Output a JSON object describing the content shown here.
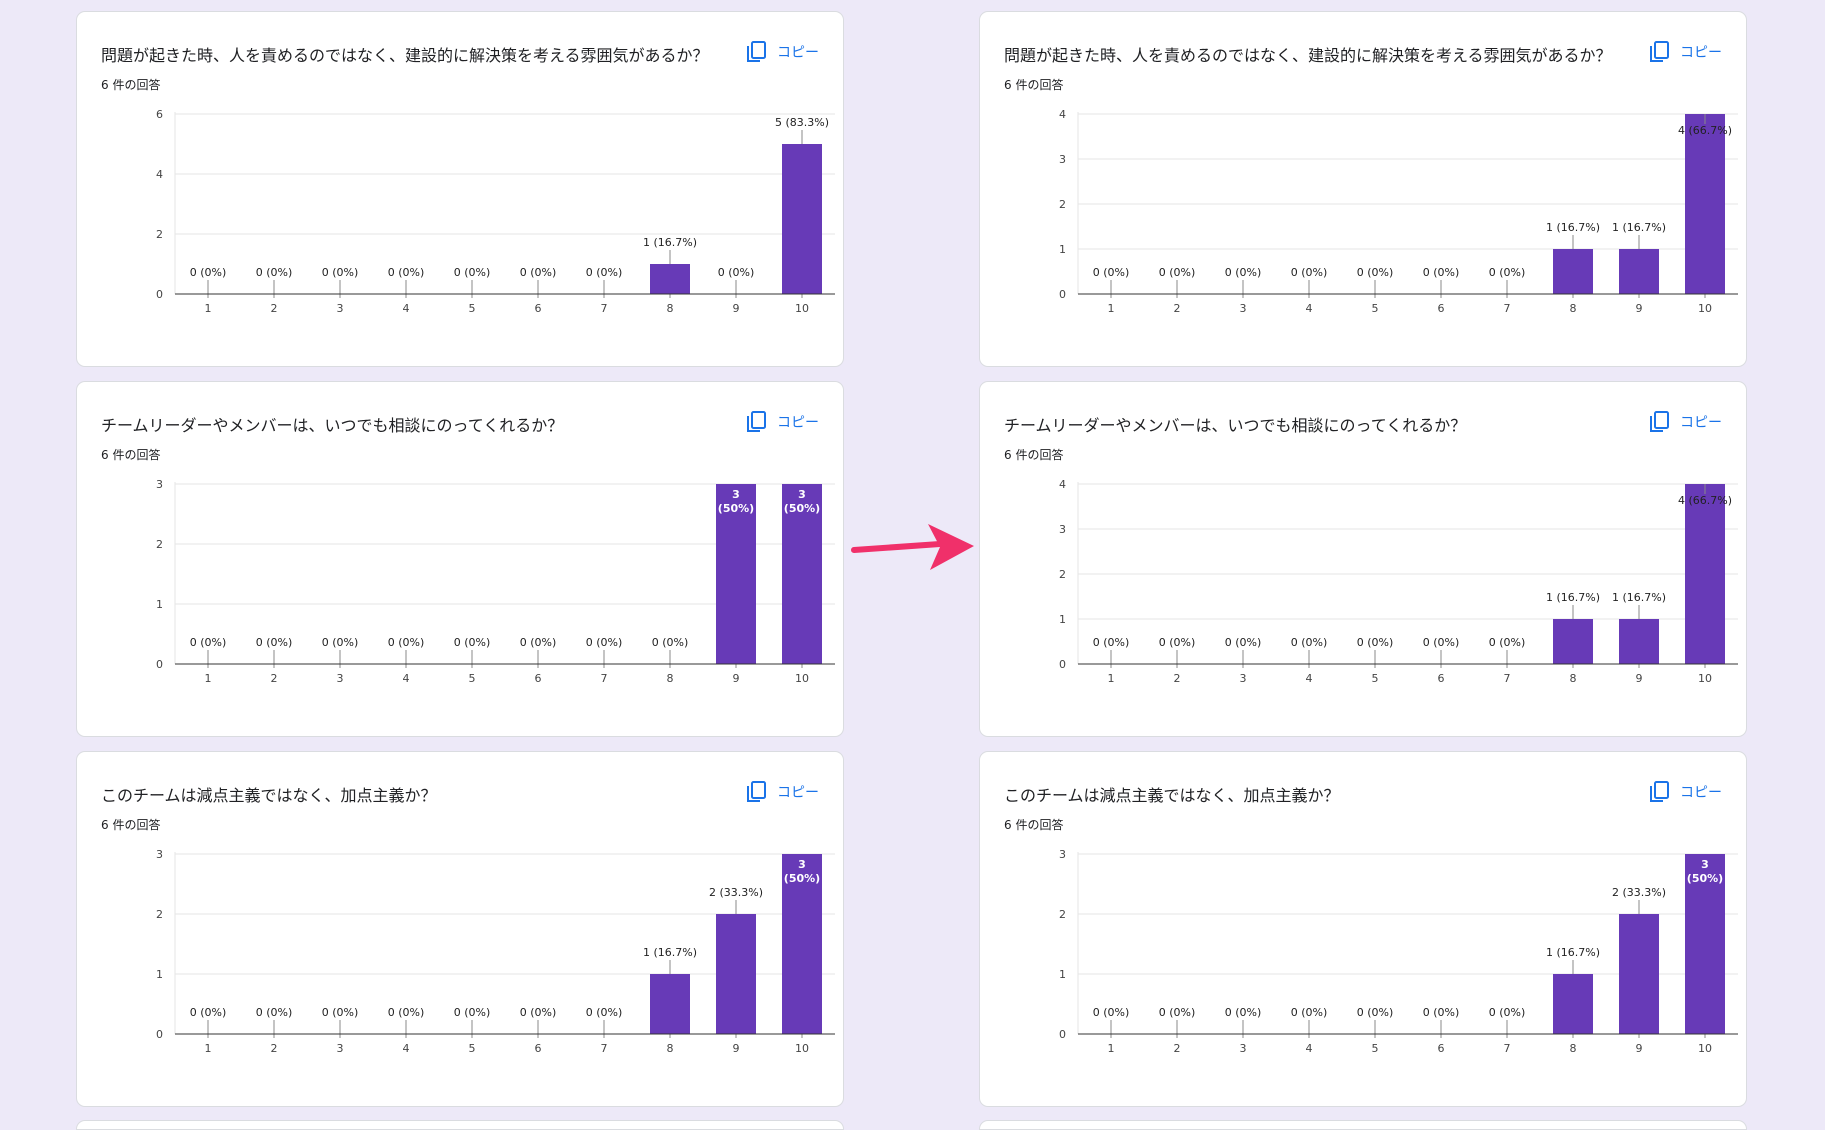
{
  "colors": {
    "bar": "#673ab7",
    "copy": "#1a73e8",
    "arrow": "#f0306a"
  },
  "icons": {
    "copy": "copy-icon",
    "arrow": "arrow-icon"
  },
  "left": {
    "cards": [
      {
        "title": "問題が起きた時、人を責めるのではなく、建設的に解決策を考える雰囲気があるか？",
        "count": "6 件の回答",
        "copy_label": "コピー",
        "chart_data": {
          "type": "bar",
          "categories": [
            "1",
            "2",
            "3",
            "4",
            "5",
            "6",
            "7",
            "8",
            "9",
            "10"
          ],
          "values": [
            0,
            0,
            0,
            0,
            0,
            0,
            0,
            1,
            0,
            5
          ],
          "labels": [
            "0 (0%)",
            "0 (0%)",
            "0 (0%)",
            "0 (0%)",
            "0 (0%)",
            "0 (0%)",
            "0 (0%)",
            "1 (16.7%)",
            "0 (0%)",
            "5 (83.3%)"
          ],
          "yticks": [
            0,
            2,
            4,
            6
          ],
          "ylim": [
            0,
            6
          ]
        }
      },
      {
        "title": "チームリーダーやメンバーは、いつでも相談にのってくれるか？",
        "count": "6 件の回答",
        "copy_label": "コピー",
        "chart_data": {
          "type": "bar",
          "categories": [
            "1",
            "2",
            "3",
            "4",
            "5",
            "6",
            "7",
            "8",
            "9",
            "10"
          ],
          "values": [
            0,
            0,
            0,
            0,
            0,
            0,
            0,
            0,
            3,
            3
          ],
          "labels": [
            "0 (0%)",
            "0 (0%)",
            "0 (0%)",
            "0 (0%)",
            "0 (0%)",
            "0 (0%)",
            "0 (0%)",
            "0 (0%)",
            "3\n(50%)",
            "3\n(50%)"
          ],
          "yticks": [
            0,
            1,
            2,
            3
          ],
          "ylim": [
            0,
            3
          ]
        }
      },
      {
        "title": "このチームは減点主義ではなく、加点主義か？",
        "count": "6 件の回答",
        "copy_label": "コピー",
        "chart_data": {
          "type": "bar",
          "categories": [
            "1",
            "2",
            "3",
            "4",
            "5",
            "6",
            "7",
            "8",
            "9",
            "10"
          ],
          "values": [
            0,
            0,
            0,
            0,
            0,
            0,
            0,
            1,
            2,
            3
          ],
          "labels": [
            "0 (0%)",
            "0 (0%)",
            "0 (0%)",
            "0 (0%)",
            "0 (0%)",
            "0 (0%)",
            "0 (0%)",
            "1 (16.7%)",
            "2 (33.3%)",
            "3\n(50%)"
          ],
          "yticks": [
            0,
            1,
            2,
            3
          ],
          "ylim": [
            0,
            3
          ]
        }
      }
    ]
  },
  "right": {
    "cards": [
      {
        "title": "問題が起きた時、人を責めるのではなく、建設的に解決策を考える雰囲気があるか？",
        "count": "6 件の回答",
        "copy_label": "コピー",
        "chart_data": {
          "type": "bar",
          "categories": [
            "1",
            "2",
            "3",
            "4",
            "5",
            "6",
            "7",
            "8",
            "9",
            "10"
          ],
          "values": [
            0,
            0,
            0,
            0,
            0,
            0,
            0,
            1,
            1,
            4
          ],
          "labels": [
            "0 (0%)",
            "0 (0%)",
            "0 (0%)",
            "0 (0%)",
            "0 (0%)",
            "0 (0%)",
            "0 (0%)",
            "1 (16.7%)",
            "1 (16.7%)",
            "4 (66.7%)"
          ],
          "yticks": [
            0,
            1,
            2,
            3,
            4
          ],
          "ylim": [
            0,
            4
          ]
        }
      },
      {
        "title": "チームリーダーやメンバーは、いつでも相談にのってくれるか？",
        "count": "6 件の回答",
        "copy_label": "コピー",
        "chart_data": {
          "type": "bar",
          "categories": [
            "1",
            "2",
            "3",
            "4",
            "5",
            "6",
            "7",
            "8",
            "9",
            "10"
          ],
          "values": [
            0,
            0,
            0,
            0,
            0,
            0,
            0,
            1,
            1,
            4
          ],
          "labels": [
            "0 (0%)",
            "0 (0%)",
            "0 (0%)",
            "0 (0%)",
            "0 (0%)",
            "0 (0%)",
            "0 (0%)",
            "1 (16.7%)",
            "1 (16.7%)",
            "4 (66.7%)"
          ],
          "yticks": [
            0,
            1,
            2,
            3,
            4
          ],
          "ylim": [
            0,
            4
          ]
        }
      },
      {
        "title": "このチームは減点主義ではなく、加点主義か？",
        "count": "6 件の回答",
        "copy_label": "コピー",
        "chart_data": {
          "type": "bar",
          "categories": [
            "1",
            "2",
            "3",
            "4",
            "5",
            "6",
            "7",
            "8",
            "9",
            "10"
          ],
          "values": [
            0,
            0,
            0,
            0,
            0,
            0,
            0,
            1,
            2,
            3
          ],
          "labels": [
            "0 (0%)",
            "0 (0%)",
            "0 (0%)",
            "0 (0%)",
            "0 (0%)",
            "0 (0%)",
            "0 (0%)",
            "1 (16.7%)",
            "2 (33.3%)",
            "3\n(50%)"
          ],
          "yticks": [
            0,
            1,
            2,
            3
          ],
          "ylim": [
            0,
            3
          ]
        }
      }
    ]
  }
}
